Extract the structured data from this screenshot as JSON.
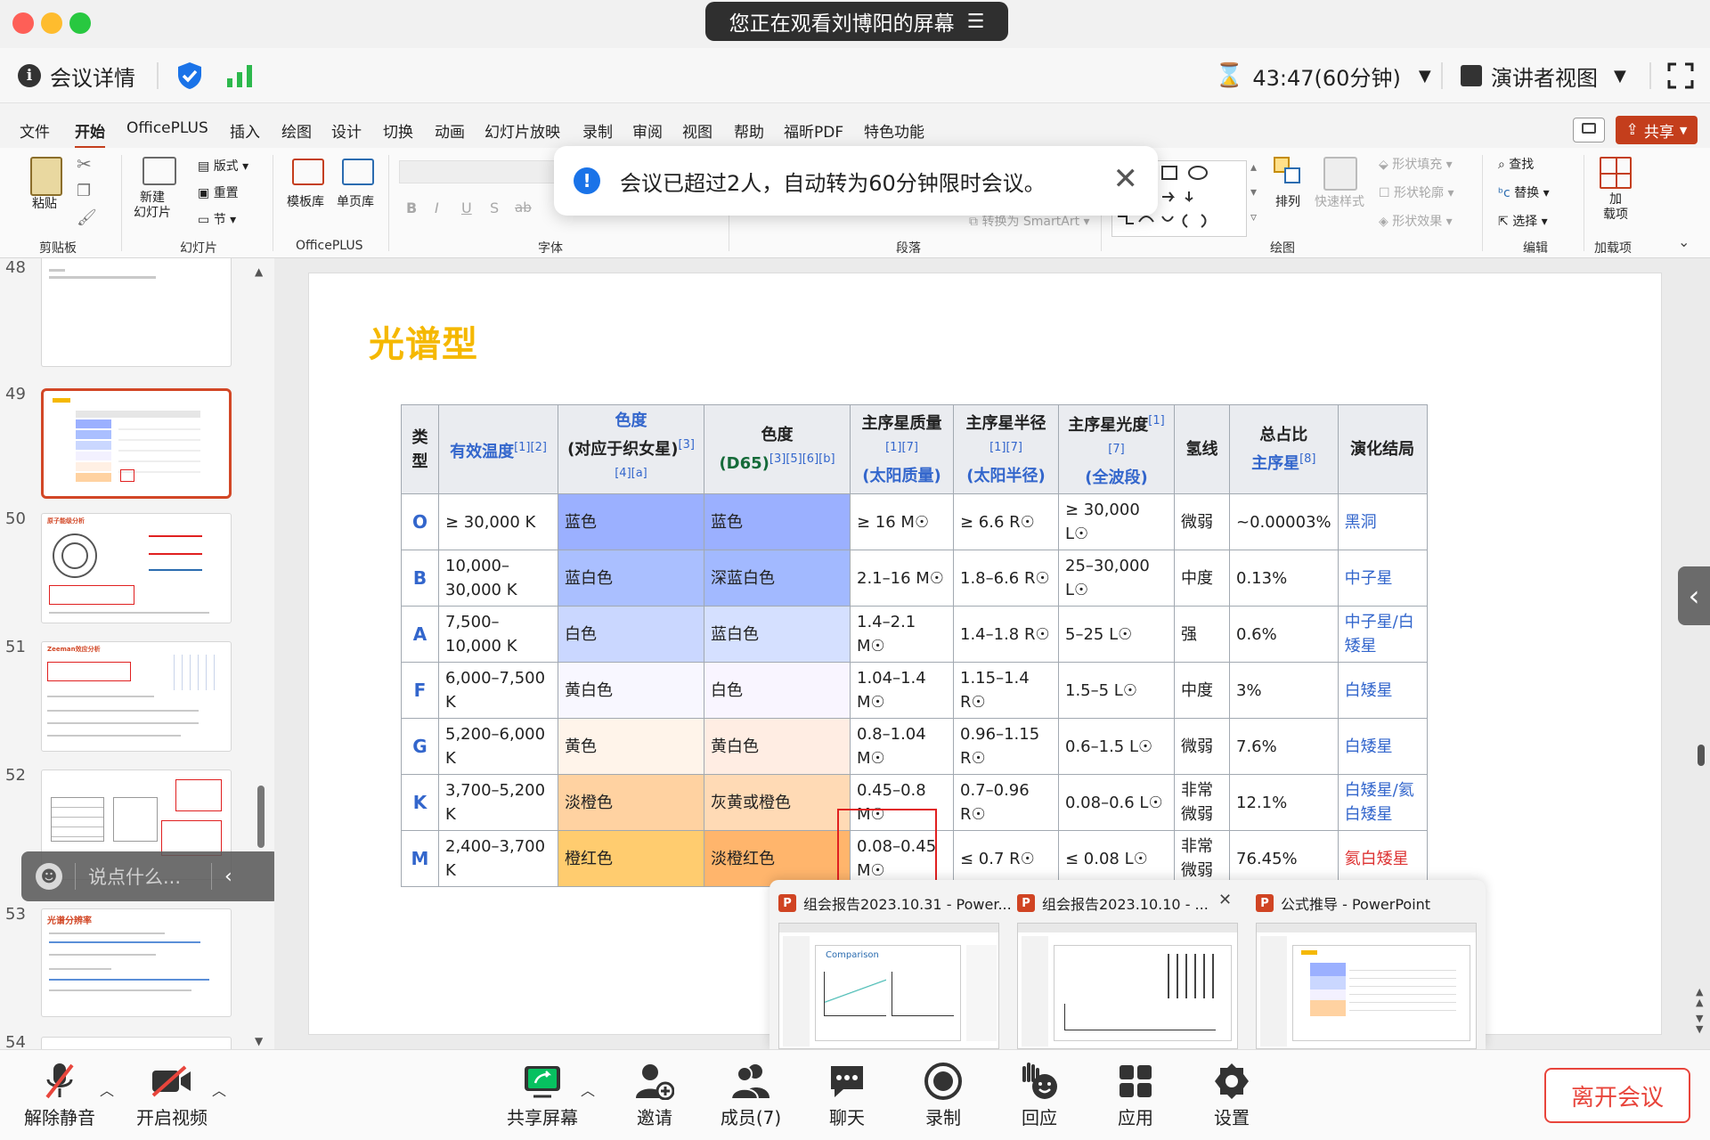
{
  "window": {
    "traffic_lights": [
      "#fe5f57",
      "#febc2e",
      "#28c840"
    ],
    "share_status": "您正在观看刘博阳的屏幕"
  },
  "infobar": {
    "details_label": "会议详情",
    "timer": "43:47(60分钟)",
    "view_label": "演讲者视图"
  },
  "ribbon": {
    "tabs": [
      "文件",
      "开始",
      "OfficePLUS",
      "插入",
      "绘图",
      "设计",
      "切换",
      "动画",
      "幻灯片放映",
      "录制",
      "审阅",
      "视图",
      "帮助",
      "福昕PDF",
      "特色功能"
    ],
    "active_tab": "开始",
    "share_button": "共享",
    "groups": {
      "clipboard": {
        "label": "剪贴板",
        "paste": "粘贴"
      },
      "slides": {
        "label": "幻灯片",
        "new_slide": "新建\n幻灯片",
        "layout": "版式",
        "reset": "重置",
        "section": "节"
      },
      "officeplus": {
        "label": "OfficePLUS",
        "template": "模板库",
        "single_page": "单页库"
      },
      "font": {
        "label": "字体"
      },
      "paragraph": {
        "label": "段落",
        "smartart": "转换为 SmartArt"
      },
      "drawing": {
        "label": "绘图",
        "arrange": "排列",
        "quick_styles": "快速样式",
        "shape_fill": "形状填充",
        "shape_outline": "形状轮廓",
        "shape_effects": "形状效果"
      },
      "editing": {
        "label": "编辑",
        "find": "查找",
        "replace": "替换",
        "select": "选择"
      },
      "addins": {
        "label": "加载项",
        "addin": "加\n载项"
      }
    }
  },
  "toast": {
    "message": "会议已超过2人，自动转为60分钟限时会议。"
  },
  "slide_panel": {
    "numbers": [
      "48",
      "49",
      "50",
      "51",
      "52",
      "53",
      "54"
    ],
    "thumb_titles": {
      "50": "原子能级分析",
      "51": "Zeeman效应分析",
      "53": "光谱分辨率"
    },
    "chat_placeholder": "说点什么..."
  },
  "slide": {
    "title": "光谱型",
    "headers": {
      "type": "类型",
      "temp": "有效温度",
      "temp_refs": "[1][2]",
      "color1_top": "色度",
      "color1_main": "(对应于织女星)",
      "color1_refs": "[3][4][a]",
      "color2_top": "色度",
      "color2_main": "(D65)",
      "color2_refs": "[3][5][6][b]",
      "mass_main": "主序星质量",
      "mass_refs": "[1][7]",
      "mass_unit": "(太阳质量)",
      "radius_main": "主序星半径",
      "radius_refs": "[1][7]",
      "radius_unit": "(太阳半径)",
      "lum_main": "主序星光度",
      "lum_refs": "[1][7]",
      "lum_unit": "(全波段)",
      "hydrogen": "氢线",
      "fraction_main": "总占比",
      "fraction_link": "主序星",
      "fraction_refs": "[8]",
      "evolution": "演化结局"
    },
    "rows": [
      {
        "cls": "O",
        "temp": "≥ 30,000 K",
        "c1": "蓝色",
        "c2": "蓝色",
        "mass": "≥ 16 M☉",
        "radius": "≥ 6.6 R☉",
        "lum": "≥ 30,000 L☉",
        "h": "微弱",
        "frac": "~0.00003%",
        "evo": "黑洞",
        "bg1": "#9bb0ff",
        "bg2": "#9bb0ff"
      },
      {
        "cls": "B",
        "temp": "10,000–30,000 K",
        "c1": "蓝白色",
        "c2": "深蓝白色",
        "mass": "2.1–16 M☉",
        "radius": "1.8–6.6 R☉",
        "lum": "25–30,000 L☉",
        "h": "中度",
        "frac": "0.13%",
        "evo": "中子星",
        "bg1": "#aabfff",
        "bg2": "#a2b9ff"
      },
      {
        "cls": "A",
        "temp": "7,500–10,000 K",
        "c1": "白色",
        "c2": "蓝白色",
        "mass": "1.4–2.1 M☉",
        "radius": "1.4–1.8 R☉",
        "lum": "5–25 L☉",
        "h": "强",
        "frac": "0.6%",
        "evo": "中子星/白矮星",
        "bg1": "#cad7ff",
        "bg2": "#d5e0ff"
      },
      {
        "cls": "F",
        "temp": "6,000–7,500 K",
        "c1": "黄白色",
        "c2": "白色",
        "mass": "1.04–1.4 M☉",
        "radius": "1.15–1.4 R☉",
        "lum": "1.5–5 L☉",
        "h": "中度",
        "frac": "3%",
        "evo": "白矮星",
        "bg1": "#f8f7ff",
        "bg2": "#f9f5ff"
      },
      {
        "cls": "G",
        "temp": "5,200–6,000 K",
        "c1": "黄色",
        "c2": "黄白色",
        "mass": "0.8–1.04 M☉",
        "radius": "0.96–1.15 R☉",
        "lum": "0.6–1.5 L☉",
        "h": "微弱",
        "frac": "7.6%",
        "evo": "白矮星",
        "bg1": "#fff4ea",
        "bg2": "#ffede3"
      },
      {
        "cls": "K",
        "temp": "3,700–5,200 K",
        "c1": "淡橙色",
        "c2": "灰黄或橙色",
        "mass": "0.45–0.8 M☉",
        "radius": "0.7–0.96 R☉",
        "lum": "0.08–0.6 L☉",
        "h": "非常微弱",
        "frac": "12.1%",
        "evo": "白矮星/氦白矮星",
        "bg1": "#ffd2a1",
        "bg2": "#ffdab5"
      },
      {
        "cls": "M",
        "temp": "2,400–3,700 K",
        "c1": "橙红色",
        "c2": "淡橙红色",
        "mass": "0.08–0.45 M☉",
        "radius": "≤ 0.7 R☉",
        "lum": "≤ 0.08 L☉",
        "h": "非常微弱",
        "frac": "76.45%",
        "evo": "氦白矮星",
        "bg1": "#ffcc6f",
        "bg2": "#ffb56c"
      }
    ]
  },
  "task_previews": [
    {
      "title": "组会报告2023.10.31 - Power..."
    },
    {
      "title": "组会报告2023.10.10 - ..."
    },
    {
      "title": "公式推导 - PowerPoint"
    }
  ],
  "bottombar": {
    "unmute": "解除静音",
    "start_video": "开启视频",
    "share_screen": "共享屏幕",
    "invite": "邀请",
    "members": "成员(7)",
    "chat": "聊天",
    "record": "录制",
    "react": "回应",
    "apps": "应用",
    "settings": "设置",
    "leave": "离开会议"
  },
  "colors": {
    "accent_blue": "#1a73e8",
    "share_green": "#07c160",
    "leave_red": "#e8453c",
    "title_gold": "#f5b800"
  }
}
